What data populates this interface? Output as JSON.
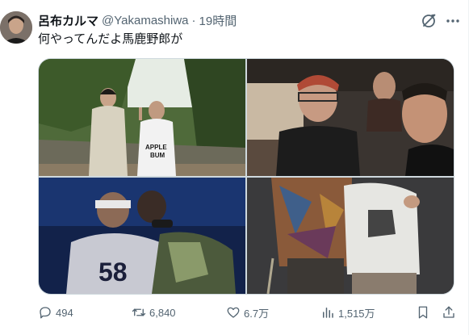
{
  "tweet": {
    "display_name": "呂布カルマ",
    "handle": "@Yakamashiwa",
    "separator": "·",
    "time": "19時間",
    "text": "何やってんだよ馬鹿野郎が"
  },
  "photos": [
    {
      "content": "two men standing outdoors in front of greenery, one making a peace sign"
    },
    {
      "content": "selfie of three men inside a car"
    },
    {
      "content": "stage performance, man in jersey number 58 hugging another man"
    },
    {
      "content": "two men posing indoors, one with a cane"
    }
  ],
  "photo_text": {
    "shirt_print_1": "APPLE",
    "shirt_print_2": "BUM",
    "jersey_number": "58"
  },
  "actions": {
    "replies": "494",
    "reposts": "6,840",
    "likes": "6.7万",
    "views": "1,515万"
  },
  "icons": {
    "reply": "reply-icon",
    "repost": "repost-icon",
    "like": "like-icon",
    "views": "views-icon",
    "bookmark": "bookmark-icon",
    "share": "share-icon",
    "grok": "grok-icon",
    "more": "more-icon"
  },
  "colors": {
    "text_primary": "#0f1419",
    "text_secondary": "#536471",
    "border": "#cfd9de"
  }
}
